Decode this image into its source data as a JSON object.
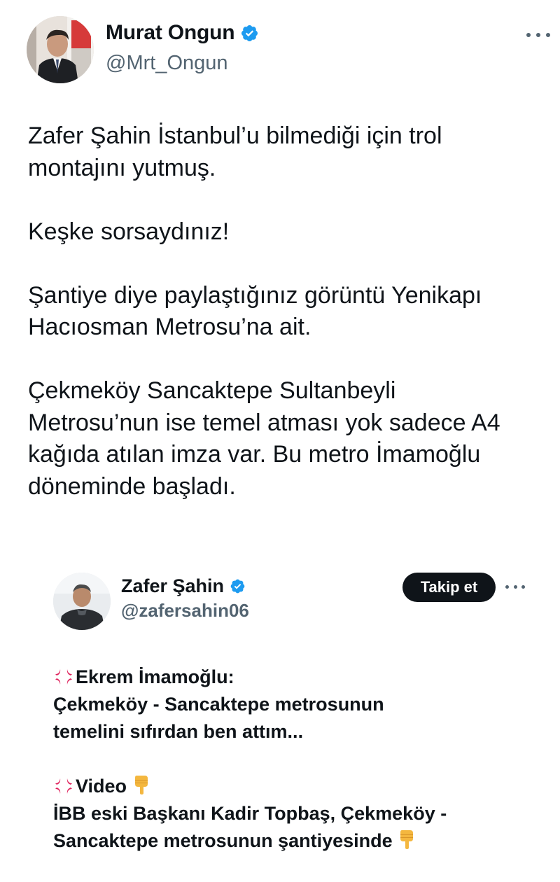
{
  "tweet": {
    "author": {
      "name": "Murat Ongun",
      "handle": "@Mrt_Ongun",
      "verified": true
    },
    "paragraphs": [
      [
        "Zafer Şahin İstanbul’u bilmediği için trol",
        "montajını yutmuş."
      ],
      [
        "Keşke sorsaydınız!"
      ],
      [
        "Şantiye diye paylaştığınız görüntü Yenikapı",
        "Hacıosman Metrosu’na ait."
      ],
      [
        "Çekmeköy Sancaktepe Sultanbeyli",
        "Metrosu’nun ise temel atması yok sadece A4",
        "kağıda atılan imza var. Bu metro İmamoğlu",
        "döneminde başladı."
      ]
    ]
  },
  "quoted": {
    "author": {
      "name": "Zafer Şahin",
      "handle": "@zafersahin06",
      "verified": true
    },
    "follow_label": "Takip et",
    "block1": {
      "heading": "Ekrem İmamoğlu:",
      "line1": "Çekmeköy - Sancaktepe metrosunun",
      "line2": "temelini sıfırdan ben attım..."
    },
    "block2": {
      "heading": "Video",
      "line1": "İBB eski Başkanı Kadir Topbaş, Çekmeköy -",
      "line2": "Sancaktepe metrosunun şantiyesinde"
    }
  },
  "colors": {
    "verified": "#1d9bf0",
    "text": "#0f1419",
    "secondary": "#536471",
    "anger_emoji": "#e0245e",
    "pointing_emoji": "#f4b73f"
  }
}
